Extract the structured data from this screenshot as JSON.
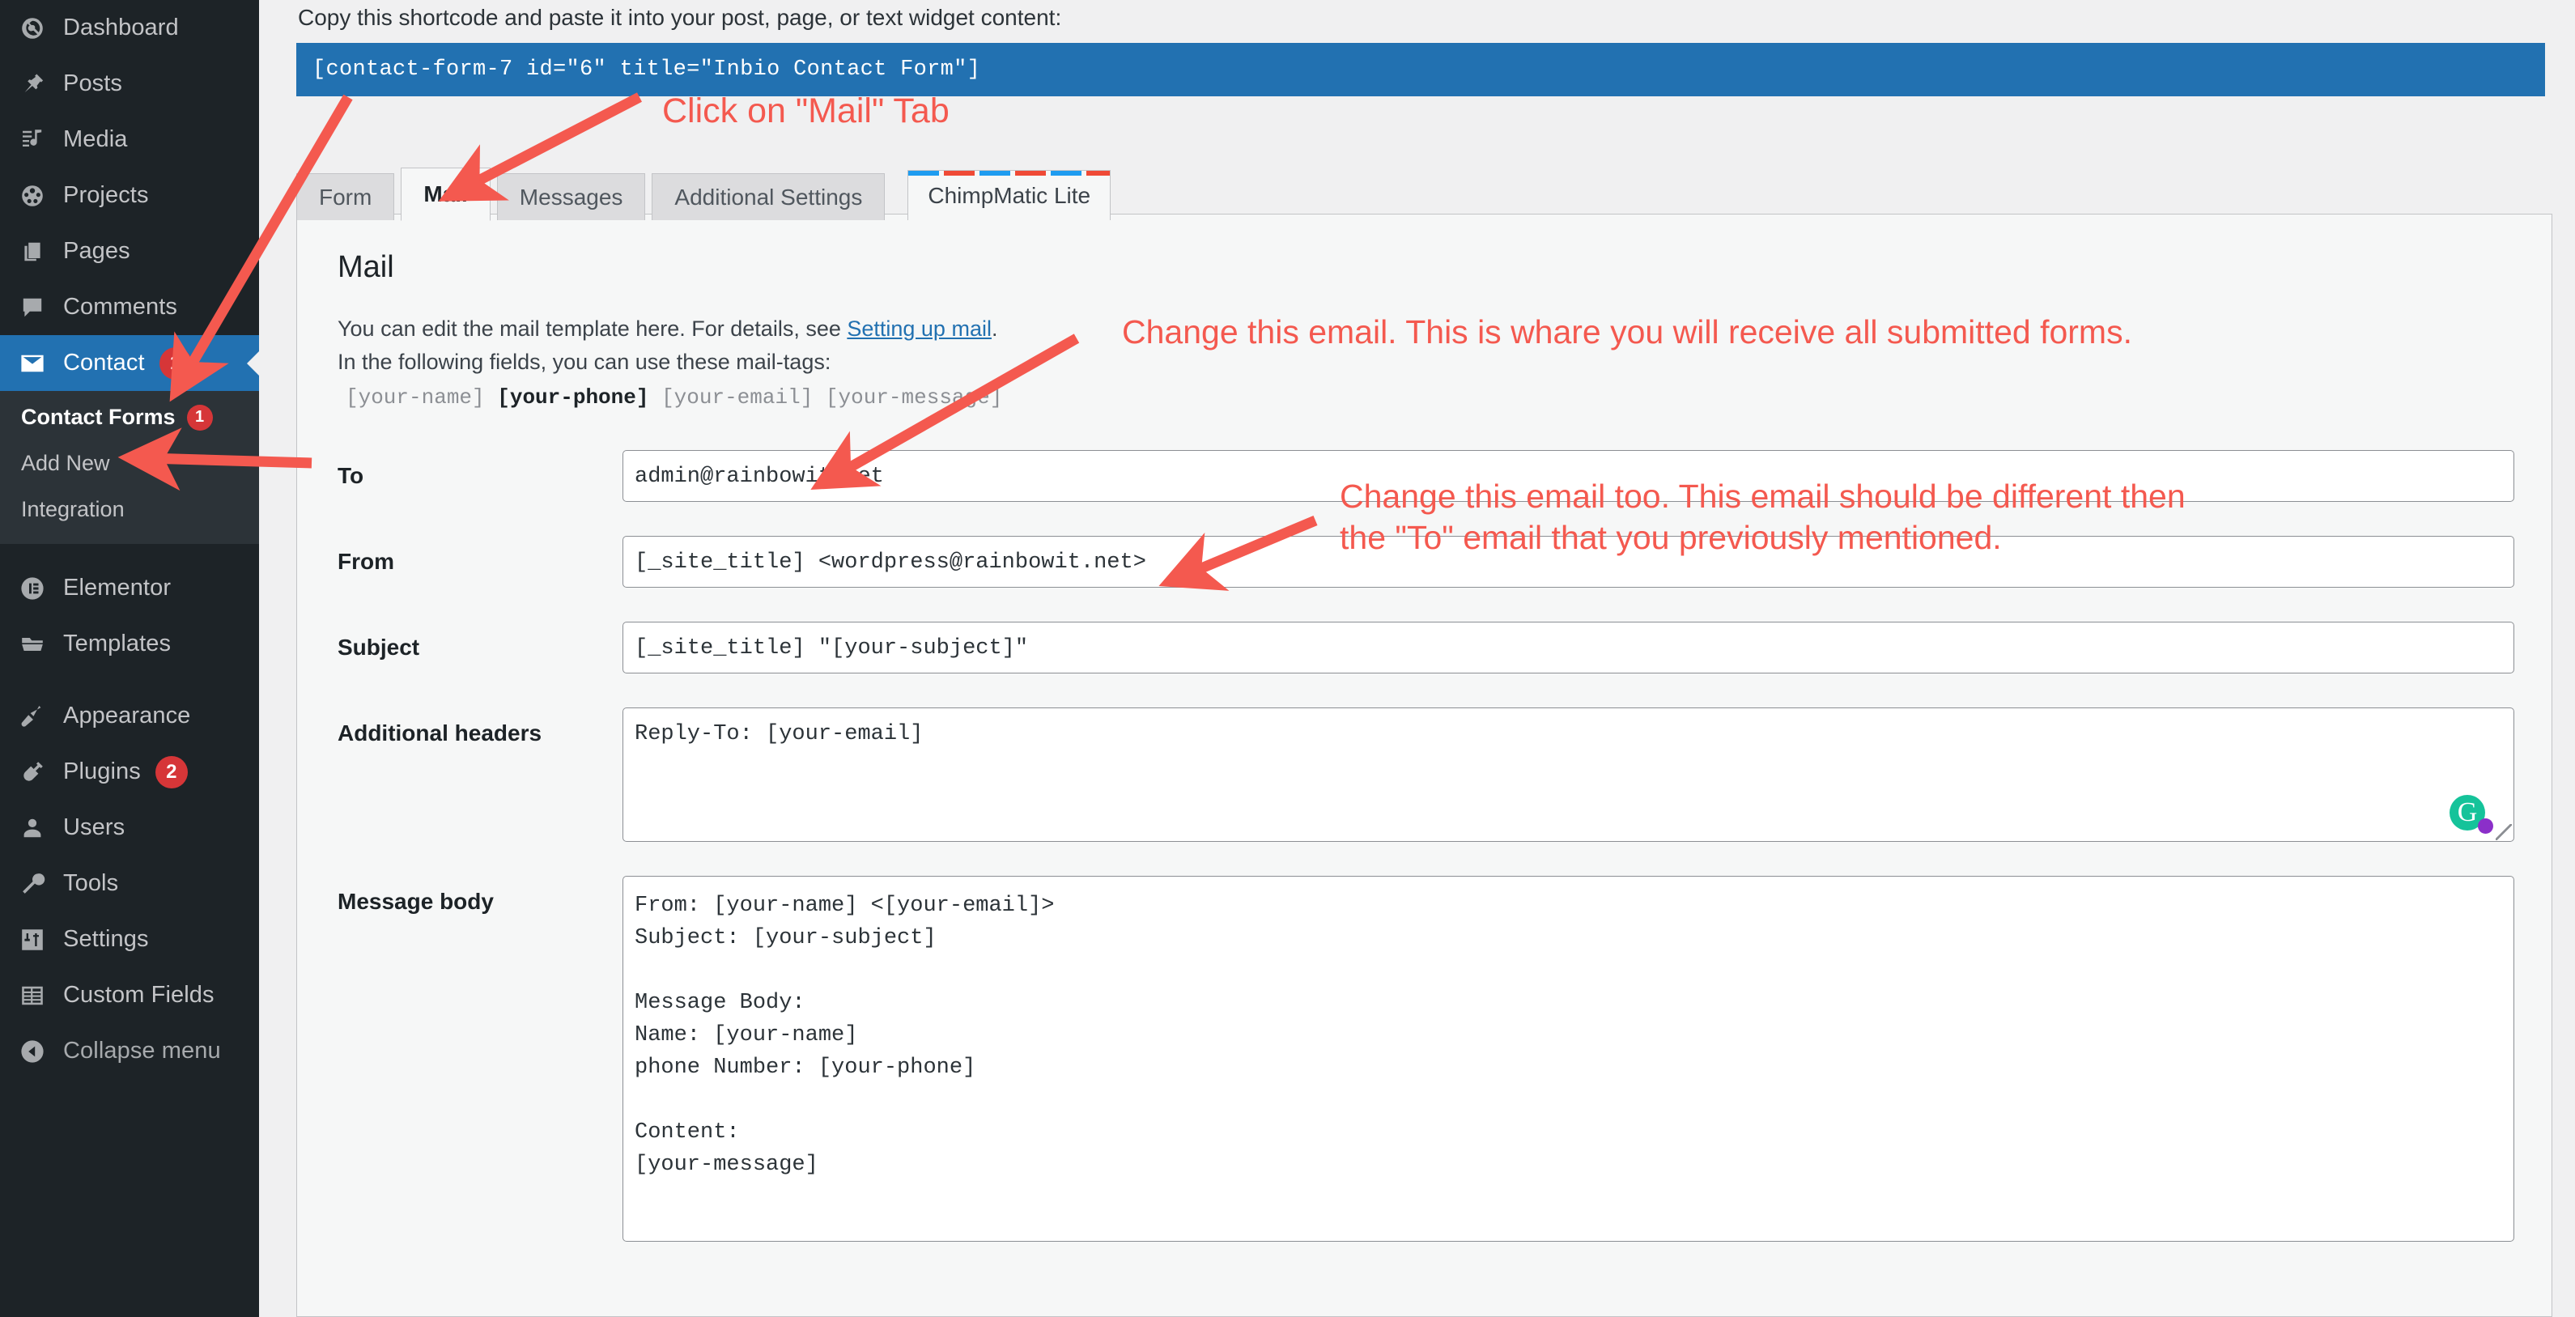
{
  "sidebar": {
    "items": [
      {
        "label": "Dashboard",
        "icon": "dashboard-icon",
        "badge": null,
        "active": false
      },
      {
        "label": "Posts",
        "icon": "pin-icon",
        "badge": null,
        "active": false
      },
      {
        "label": "Media",
        "icon": "media-icon",
        "badge": null,
        "active": false
      },
      {
        "label": "Projects",
        "icon": "film-icon",
        "badge": null,
        "active": false
      },
      {
        "label": "Pages",
        "icon": "pages-icon",
        "badge": null,
        "active": false
      },
      {
        "label": "Comments",
        "icon": "comment-icon",
        "badge": null,
        "active": false
      },
      {
        "label": "Contact",
        "icon": "envelope-icon",
        "badge": "1",
        "active": true
      }
    ],
    "submenu": [
      {
        "label": "Contact Forms",
        "badge": "1",
        "current": true
      },
      {
        "label": "Add New",
        "badge": null,
        "current": false
      },
      {
        "label": "Integration",
        "badge": null,
        "current": false
      }
    ],
    "items2": [
      {
        "label": "Elementor",
        "icon": "elementor-icon",
        "badge": null
      },
      {
        "label": "Templates",
        "icon": "folder-icon",
        "badge": null
      }
    ],
    "items3": [
      {
        "label": "Appearance",
        "icon": "brush-icon",
        "badge": null
      },
      {
        "label": "Plugins",
        "icon": "plug-icon",
        "badge": "2"
      },
      {
        "label": "Users",
        "icon": "user-icon",
        "badge": null
      },
      {
        "label": "Tools",
        "icon": "wrench-icon",
        "badge": null
      },
      {
        "label": "Settings",
        "icon": "settings-icon",
        "badge": null
      },
      {
        "label": "Custom Fields",
        "icon": "custom-fields-icon",
        "badge": null
      }
    ],
    "collapse": {
      "label": "Collapse menu",
      "icon": "collapse-arrow-icon"
    }
  },
  "shortcode": {
    "hint": "Copy this shortcode and paste it into your post, page, or text widget content:",
    "value": "[contact-form-7 id=\"6\" title=\"Inbio Contact Form\"]"
  },
  "tabs": [
    {
      "label": "Form",
      "active": false
    },
    {
      "label": "Mail",
      "active": true
    },
    {
      "label": "Messages",
      "active": false
    },
    {
      "label": "Additional Settings",
      "active": false
    },
    {
      "label": "ChimpMatic Lite",
      "active": false,
      "promo": true
    }
  ],
  "panel": {
    "title": "Mail",
    "desc_part1": "You can edit the mail template here. For details, see ",
    "desc_link": "Setting up mail",
    "desc_part2": ".",
    "desc_line2": "In the following fields, you can use these mail-tags:",
    "mailtags_pre": "[your-name] ",
    "mailtags_bold": "[your-phone]",
    "mailtags_post": " [your-email] [your-message]"
  },
  "fields": {
    "to": {
      "label": "To",
      "value": "admin@rainbowit.net"
    },
    "from": {
      "label": "From",
      "value": "[_site_title] <wordpress@rainbowit.net>"
    },
    "subject": {
      "label": "Subject",
      "value": "[_site_title] \"[your-subject]\""
    },
    "additional_headers": {
      "label": "Additional headers",
      "value": "Reply-To: [your-email]"
    },
    "message_body": {
      "label": "Message body",
      "value": "From: [your-name] <[your-email]>\nSubject: [your-subject]\n\nMessage Body:\nName: [your-name]\nphone Number: [your-phone]\n\nContent:\n[your-message]\n\n\n--"
    }
  },
  "annotations": {
    "mail_tab": "Click on \"Mail\" Tab",
    "to_field": "Change this email. This is whare you will receive all submitted forms.",
    "from_field": "Change this email too. This email should be different then\nthe \"To\" email that you previously mentioned."
  },
  "grammarly": {
    "glyph": "G"
  },
  "colors": {
    "sidebar_bg": "#1d2327",
    "submenu_bg": "#2c3338",
    "accent_blue": "#2271b1",
    "badge_red": "#d63638",
    "annotation_red": "#f4594f",
    "grammarly_green": "#15c39a",
    "grammarly_purple": "#8b2fc9"
  }
}
